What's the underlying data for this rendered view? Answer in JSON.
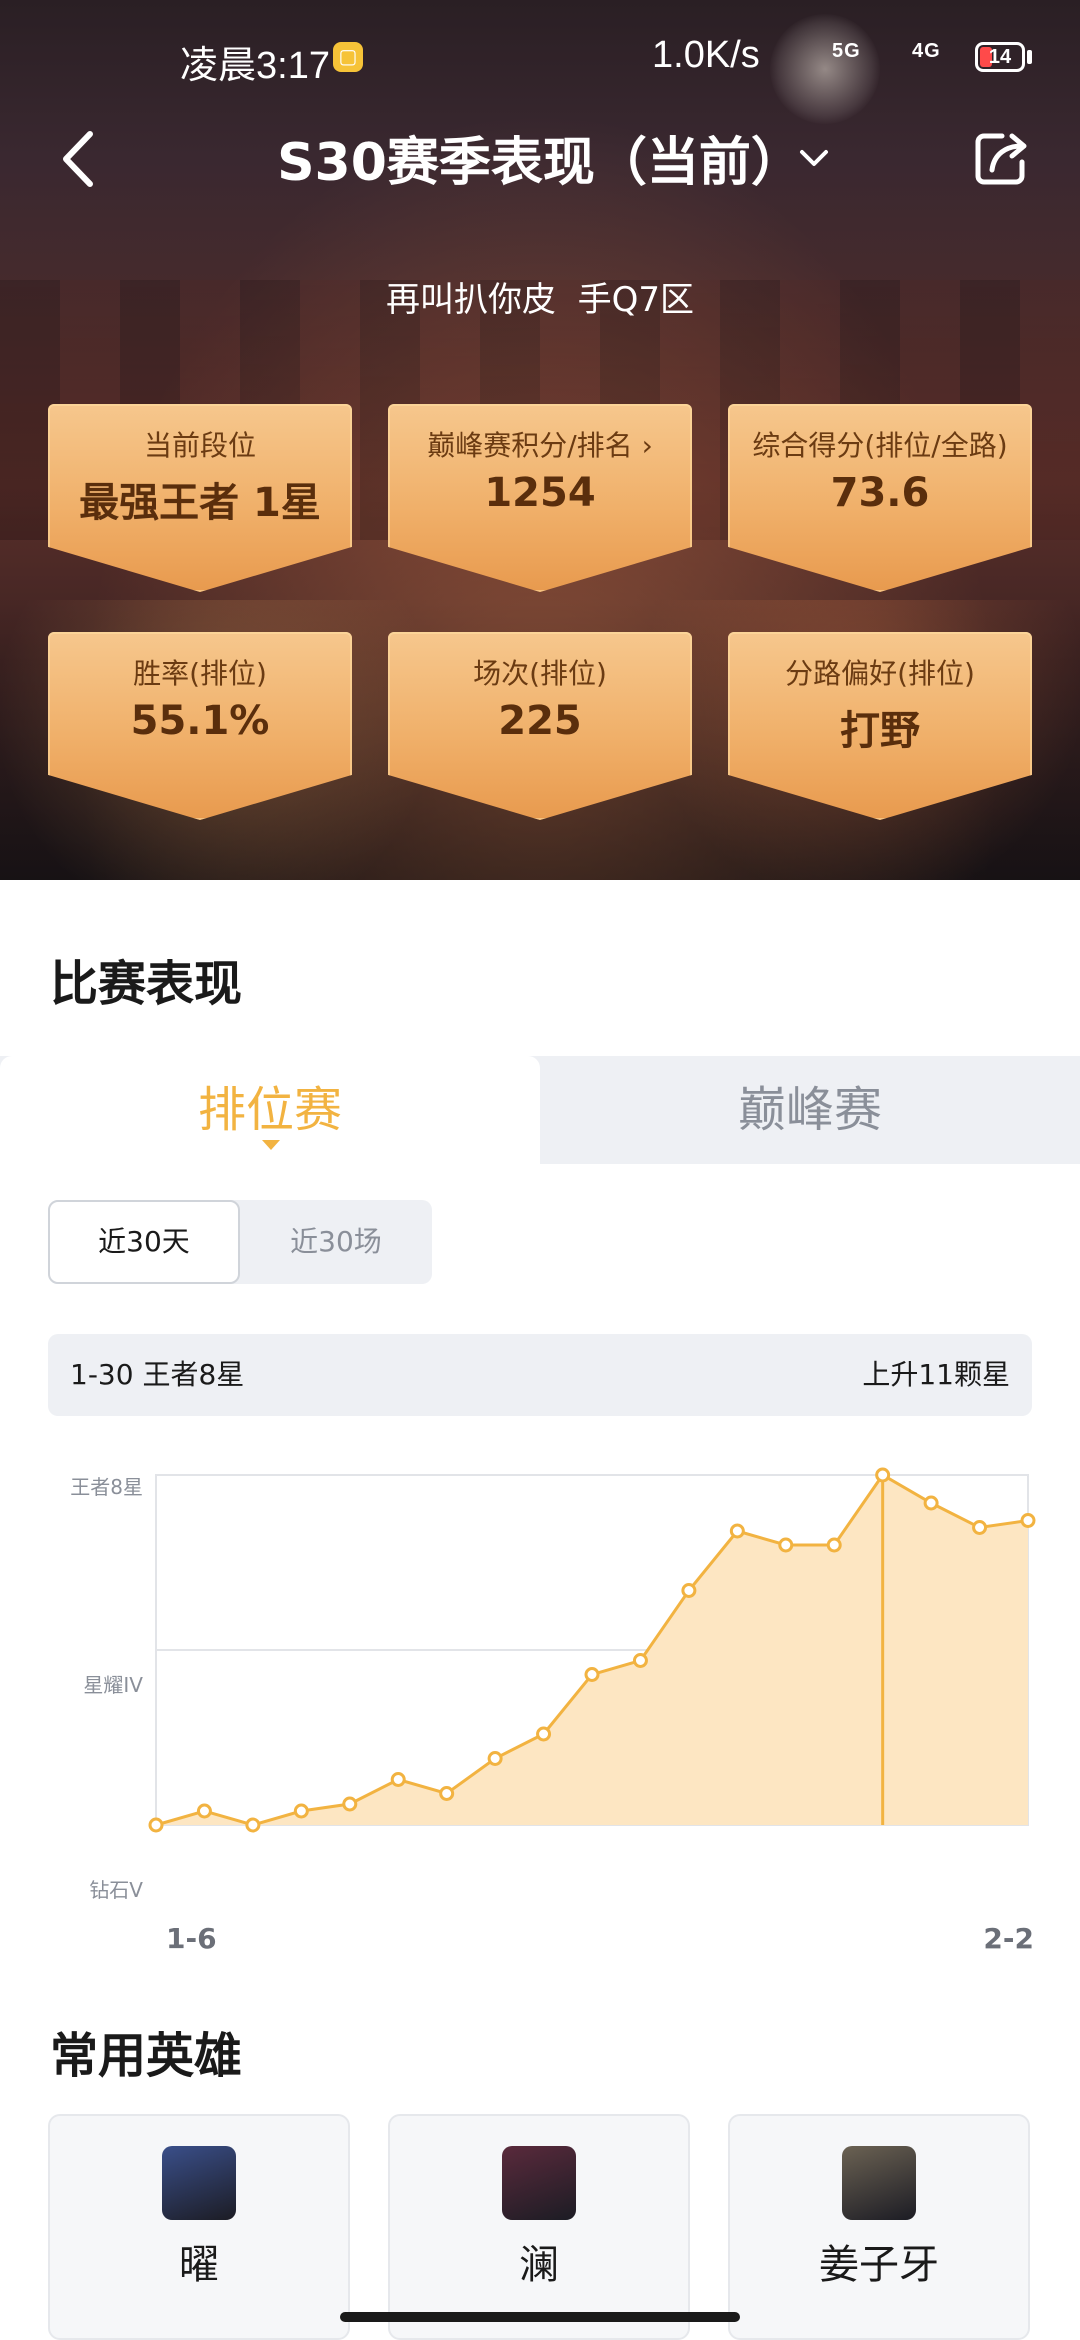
{
  "status_bar": {
    "time": "凌晨3:17",
    "net_speed": "1.0K/s",
    "net1": "5G",
    "net2": "4G",
    "battery": "14"
  },
  "header": {
    "title": "S30赛季表现（当前）",
    "player": "再叫扒你皮",
    "server": "手Q7区"
  },
  "stats": [
    {
      "label": "当前段位",
      "value": "最强王者 1星"
    },
    {
      "label": "巅峰赛积分/排名",
      "value": "1254"
    },
    {
      "label": "综合得分(排位/全路)",
      "value": "73.6"
    },
    {
      "label": "胜率(排位)",
      "value": "55.1%"
    },
    {
      "label": "场次(排位)",
      "value": "225"
    },
    {
      "label": "分路偏好(排位)",
      "value": "打野"
    }
  ],
  "performance": {
    "title": "比赛表现",
    "tabs": [
      "排位赛",
      "巅峰赛"
    ],
    "active_tab": "排位赛",
    "range_options": [
      "近30天",
      "近30场"
    ],
    "active_range": "近30天",
    "summary_left": "1-30 王者8星",
    "summary_right": "上升11颗星"
  },
  "chart_data": {
    "type": "area",
    "y_labels": [
      "王者8星",
      "星耀IV",
      "钻石V"
    ],
    "x_start_label": "1-6",
    "x_end_label": "2-2",
    "values": [
      0,
      0.04,
      0.0,
      0.04,
      0.06,
      0.13,
      0.09,
      0.19,
      0.26,
      0.43,
      0.47,
      0.67,
      0.84,
      0.8,
      0.8,
      1.0,
      0.92,
      0.85,
      0.87
    ],
    "highlight_index": 15,
    "grid": true,
    "colors": {
      "line": "#f2b341",
      "fill": "#fde6c2",
      "grid": "#e2e4e8"
    }
  },
  "heroes": {
    "title": "常用英雄",
    "items": [
      {
        "name": "曜",
        "color": "#3a4f8a"
      },
      {
        "name": "澜",
        "color": "#5a2a3c"
      },
      {
        "name": "姜子牙",
        "color": "#6b6253"
      }
    ]
  },
  "colors": {
    "accent": "#f2b341",
    "card_gradient_top": "#f6c78d",
    "card_gradient_bottom": "#e89a4e"
  }
}
